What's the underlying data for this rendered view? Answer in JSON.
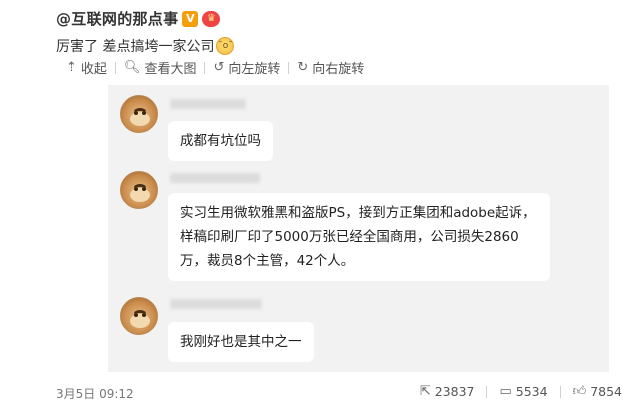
{
  "post": {
    "username": "@互联网的那点事",
    "verified_badge": "V",
    "text": "厉害了 差点搞垮一家公司",
    "emoji_icon": "awkward-face-emoji"
  },
  "toolbar": {
    "collapse": {
      "icon": "arrow-up-icon",
      "label": "收起"
    },
    "view_large": {
      "icon": "magnifier-icon",
      "label": "查看大图"
    },
    "rotate_left": {
      "icon": "rotate-left-icon",
      "label": "向左旋转"
    },
    "rotate_right": {
      "icon": "rotate-right-icon",
      "label": "向右旋转"
    }
  },
  "chat": {
    "messages": [
      {
        "text": "成都有坑位吗"
      },
      {
        "text": "实习生用微软雅黑和盗版PS，接到方正集团和adobe起诉，样稿印刷厂印了5000万张已经全国商用，公司损失2860万，裁员8个主管，42个人。"
      },
      {
        "text": "我刚好也是其中之一"
      }
    ]
  },
  "footer": {
    "time": "3月5日 09:12",
    "reposts": "23837",
    "comments": "5534",
    "likes": "7854"
  }
}
